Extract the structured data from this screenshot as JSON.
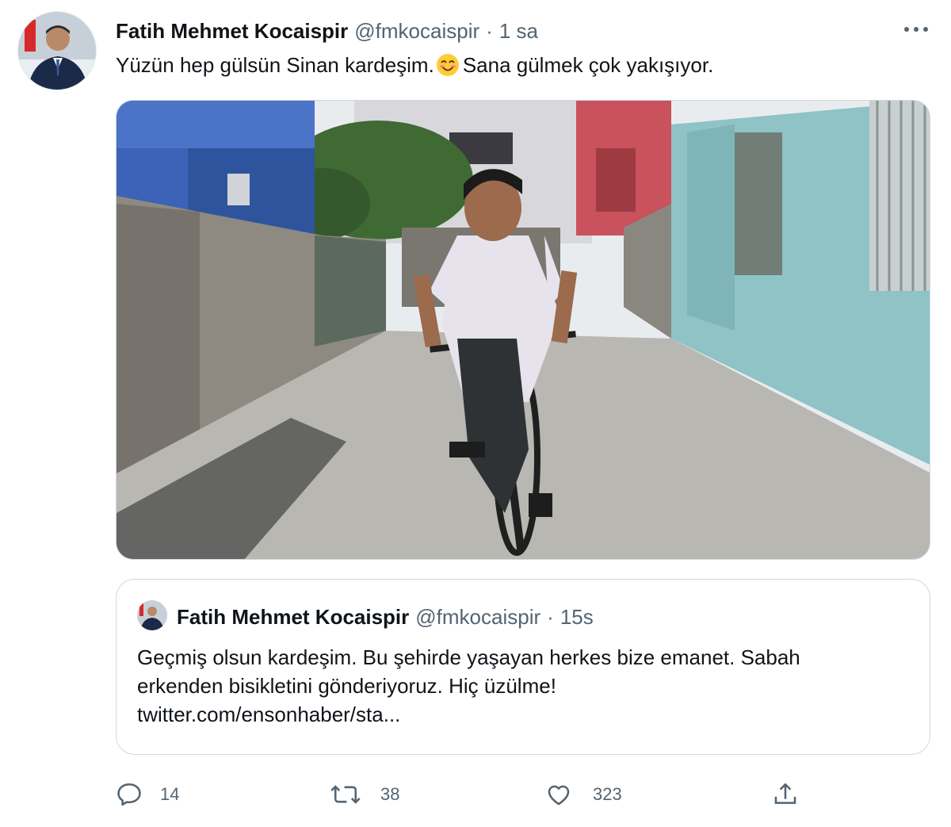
{
  "tweet": {
    "author_name": "Fatih Mehmet Kocaispir",
    "handle": "@fmkocaispir",
    "separator": "·",
    "time": "1 sa",
    "text_before_emoji": "Yüzün hep gülsün Sinan kardeşim.",
    "emoji": "smiling-face-with-smiling-eyes",
    "text_after_emoji": "Sana gülmek çok yakışıyor.",
    "more_icon": "more-horizontal-icon",
    "media_description_icon": "photo"
  },
  "quote": {
    "author_name": "Fatih Mehmet Kocaispir",
    "handle": "@fmkocaispir",
    "separator": "·",
    "time": "15s",
    "lines": [
      "Geçmiş olsun kardeşim. Bu şehirde yaşayan herkes bize emanet.  Sabah",
      "erkenden bisikletini gönderiyoruz.  Hiç üzülme!",
      "twitter.com/ensonhaber/sta..."
    ]
  },
  "actions": {
    "reply": {
      "icon": "reply-icon",
      "count": "14"
    },
    "retweet": {
      "icon": "retweet-icon",
      "count": "38"
    },
    "like": {
      "icon": "heart-icon",
      "count": "323"
    },
    "share": {
      "icon": "share-icon"
    }
  },
  "colors": {
    "text": "#0f1419",
    "secondary": "#536471",
    "border": "#cfd9de",
    "background": "#ffffff"
  }
}
